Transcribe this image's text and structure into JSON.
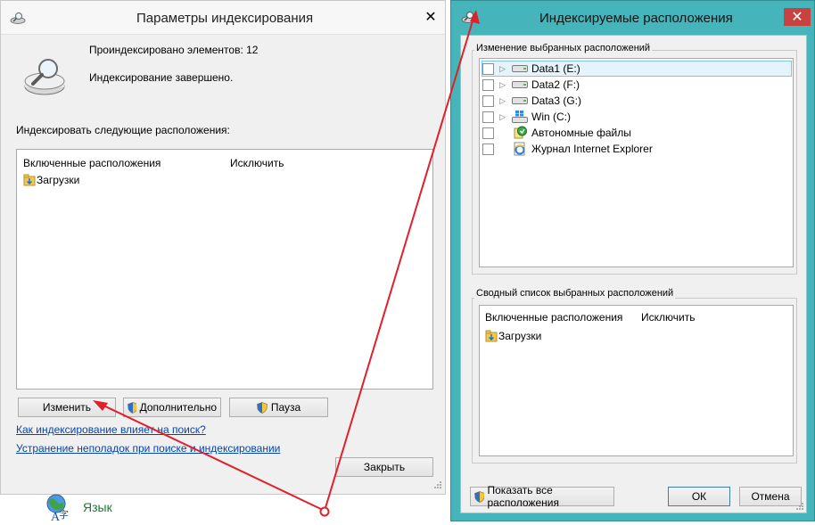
{
  "left_window": {
    "title": "Параметры индексирования",
    "items_indexed": "Проиндексировано элементов: 12",
    "status": "Индексирование завершено.",
    "section_label": "Индексировать следующие расположения:",
    "columns": [
      "Включенные расположения",
      "Исключить"
    ],
    "locations": [
      "Загрузки"
    ],
    "buttons": {
      "modify": "Изменить",
      "advanced": "Дополнительно",
      "pause": "Пауза",
      "close": "Закрыть"
    },
    "links": [
      "Как индексирование влияет на поиск?",
      "Устранение неполадок при поиске и индексировании"
    ]
  },
  "right_window": {
    "title": "Индексируемые расположения",
    "change_group_label": "Изменение выбранных расположений",
    "tree_items": [
      {
        "label": "Data1 (E:)",
        "icon": "drive-icon",
        "expandable": true,
        "selected": true
      },
      {
        "label": "Data2 (F:)",
        "icon": "drive-icon",
        "expandable": true,
        "selected": false
      },
      {
        "label": "Data3 (G:)",
        "icon": "drive-icon",
        "expandable": true,
        "selected": false
      },
      {
        "label": "Win (C:)",
        "icon": "windows-drive-icon",
        "expandable": true,
        "selected": false
      },
      {
        "label": "Автономные файлы",
        "icon": "offline-files-icon",
        "expandable": false,
        "selected": false
      },
      {
        "label": "Журнал Internet Explorer",
        "icon": "ie-history-icon",
        "expandable": false,
        "selected": false
      }
    ],
    "summary_group_label": "Сводный список выбранных расположений",
    "summary_columns": [
      "Включенные расположения",
      "Исключить"
    ],
    "summary_locations": [
      "Загрузки"
    ],
    "buttons": {
      "show_all": "Показать все расположения",
      "ok": "ОК",
      "cancel": "Отмена"
    }
  },
  "taskbar_item": {
    "label": "Язык"
  },
  "colors": {
    "accent_frame": "#45b5bb",
    "close_button": "#c74240",
    "annotation": "#e0202a",
    "link": "#0645ad"
  }
}
